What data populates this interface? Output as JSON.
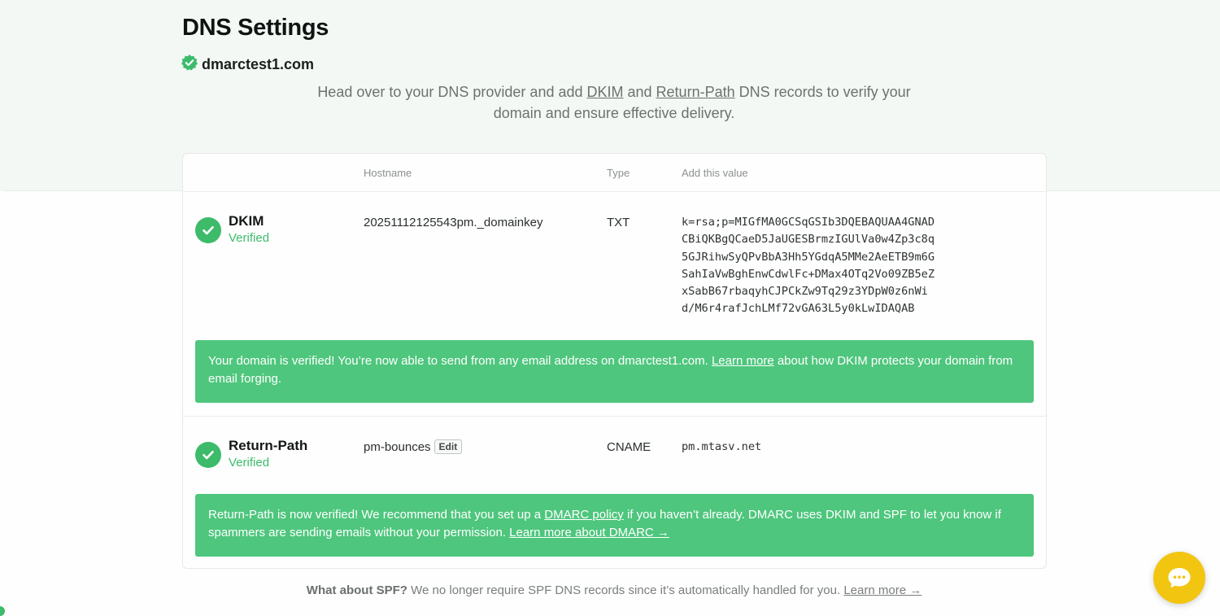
{
  "page": {
    "title": "DNS Settings"
  },
  "domain": {
    "name": "dmarctest1.com"
  },
  "intro": {
    "text_1": "Head over to your DNS provider and add ",
    "dkim_link": "DKIM",
    "text_2": " and ",
    "return_path_link": "Return-Path",
    "text_3": " DNS records to verify your domain and ensure effective delivery."
  },
  "table": {
    "headers": {
      "hostname": "Hostname",
      "type": "Type",
      "value": "Add this value"
    },
    "dkim": {
      "name": "DKIM",
      "status": "Verified",
      "hostname": "20251112125543pm._domainkey",
      "type": "TXT",
      "value_lines": [
        "k=rsa;p=MIGfMA0GCSqGSIb3DQEBAQUAA4GNAD",
        "CBiQKBgQCaeD5JaUGESBrmzIGUlVa0w4Zp3c8q",
        "5GJRihwSyQPvBbA3Hh5YGdqA5MMe2AeETB9m6G",
        "SahIaVwBghEnwCdwlFc+DMax4OTq2Vo09ZB5eZ",
        "xSabB67rbaqyhCJPCkZw9Tq29z3YDpW0z6nWi",
        "d/M6r4rafJchLMf72vGA63L5y0kLwIDAQAB"
      ],
      "banner": {
        "text_1": "Your domain is verified! You’re now able to send from any email address on dmarctest1.com. ",
        "link": "Learn more",
        "text_2": " about how DKIM protects your domain from email forging."
      }
    },
    "return_path": {
      "name": "Return-Path",
      "status": "Verified",
      "hostname": "pm-bounces",
      "edit_label": "Edit",
      "type": "CNAME",
      "value": "pm.mtasv.net",
      "banner": {
        "text_1": "Return-Path is now verified! We recommend that you set up a ",
        "link_1": "DMARC policy",
        "text_2": " if you haven’t already. DMARC uses DKIM and SPF to let you know if spammers are sending emails without your permission. ",
        "link_2": "Learn more about DMARC →"
      }
    }
  },
  "footer": {
    "bold": "What about SPF?",
    "text": " We no longer require SPF DNS records since it’s automatically handled for you. ",
    "link": "Learn more →"
  },
  "icons": {
    "verified_badge": "verified-badge-icon",
    "check": "check-circle-icon",
    "chat": "chat-bubble-icon"
  },
  "colors": {
    "accent_green": "#3dbb6b",
    "banner_green": "#4ec67d",
    "chat_yellow": "#f2c511"
  }
}
